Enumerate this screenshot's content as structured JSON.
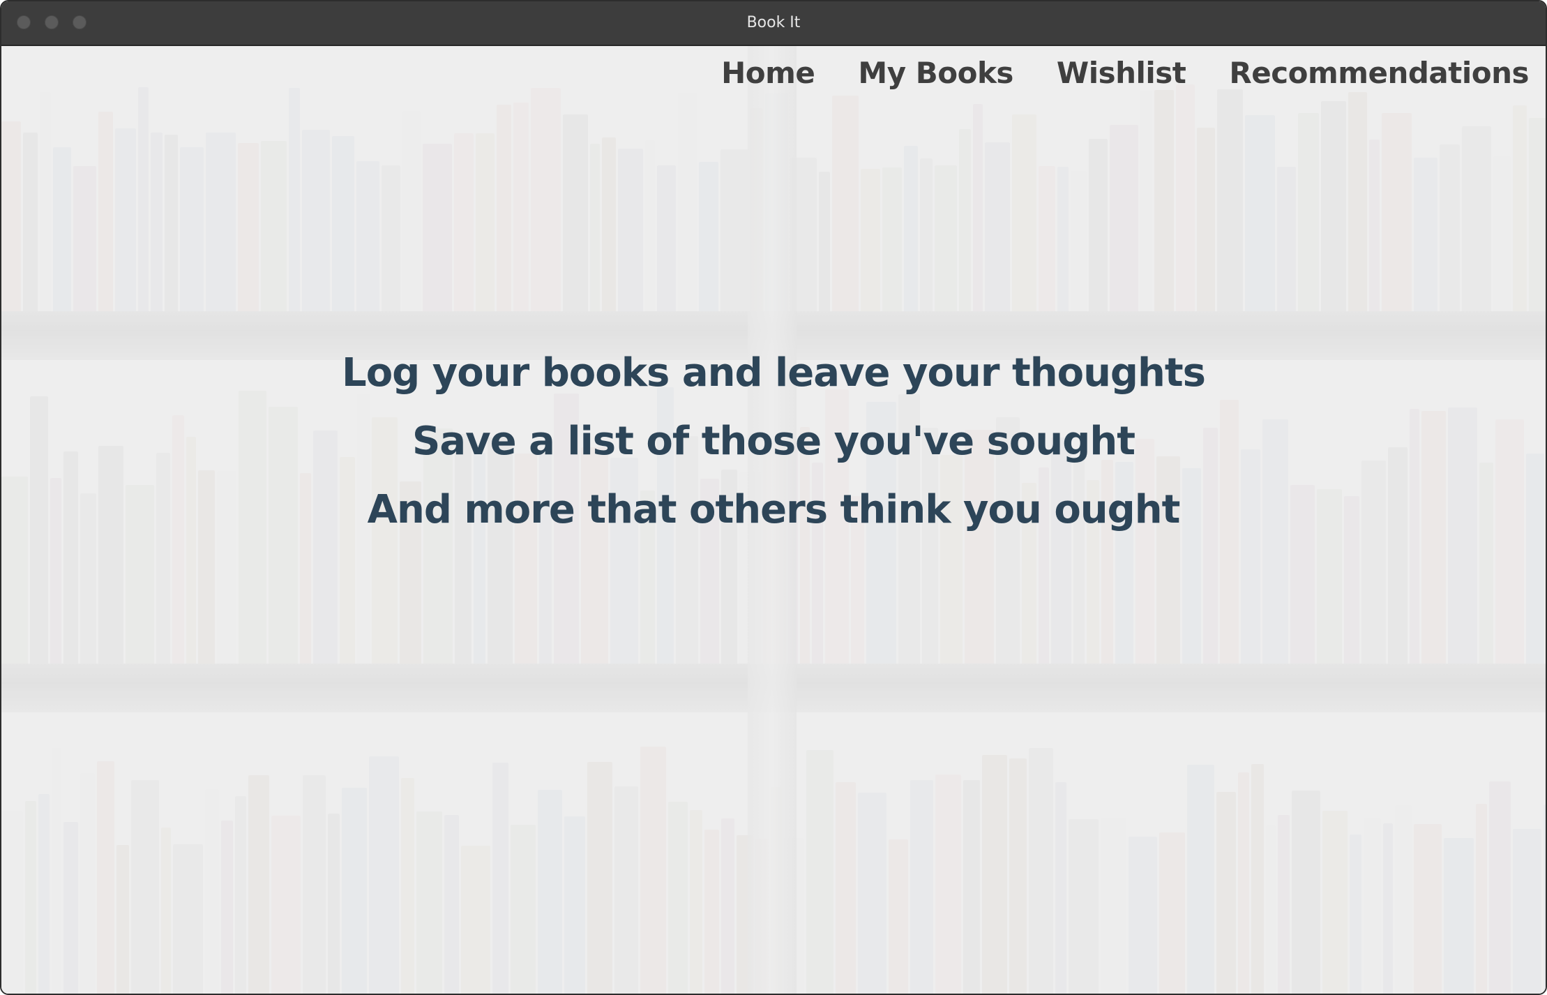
{
  "window": {
    "title": "Book It"
  },
  "nav": {
    "items": [
      {
        "label": "Home"
      },
      {
        "label": "My Books"
      },
      {
        "label": "Wishlist"
      },
      {
        "label": "Recommendations"
      }
    ]
  },
  "hero": {
    "lines": [
      "Log your books and leave your thoughts",
      "Save a list of those you've sought",
      "And more that others think you ought"
    ]
  },
  "colors": {
    "titlebar": "#3d3d3d",
    "nav_text": "#3f3f3f",
    "hero_text": "#2d4558"
  }
}
